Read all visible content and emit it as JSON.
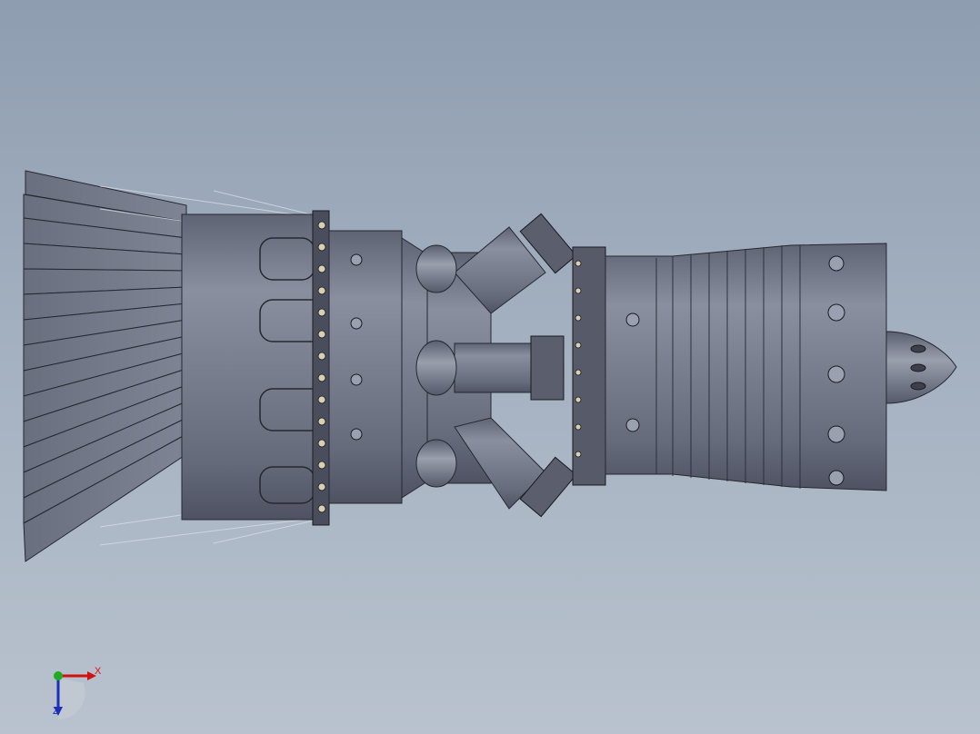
{
  "viewport": {
    "background_top": "#8e9db0",
    "background_bottom": "#b9c2ce"
  },
  "model": {
    "body_color": "#6e7384",
    "edge_color": "#26282f",
    "highlight_color": "#a6abb9",
    "bolt_color": "#d9d0b4"
  },
  "triad": {
    "x_label": "X",
    "z_label": "Z",
    "x_color": "#d11111",
    "y_color": "#22aa22",
    "z_color": "#1a2dbb"
  }
}
